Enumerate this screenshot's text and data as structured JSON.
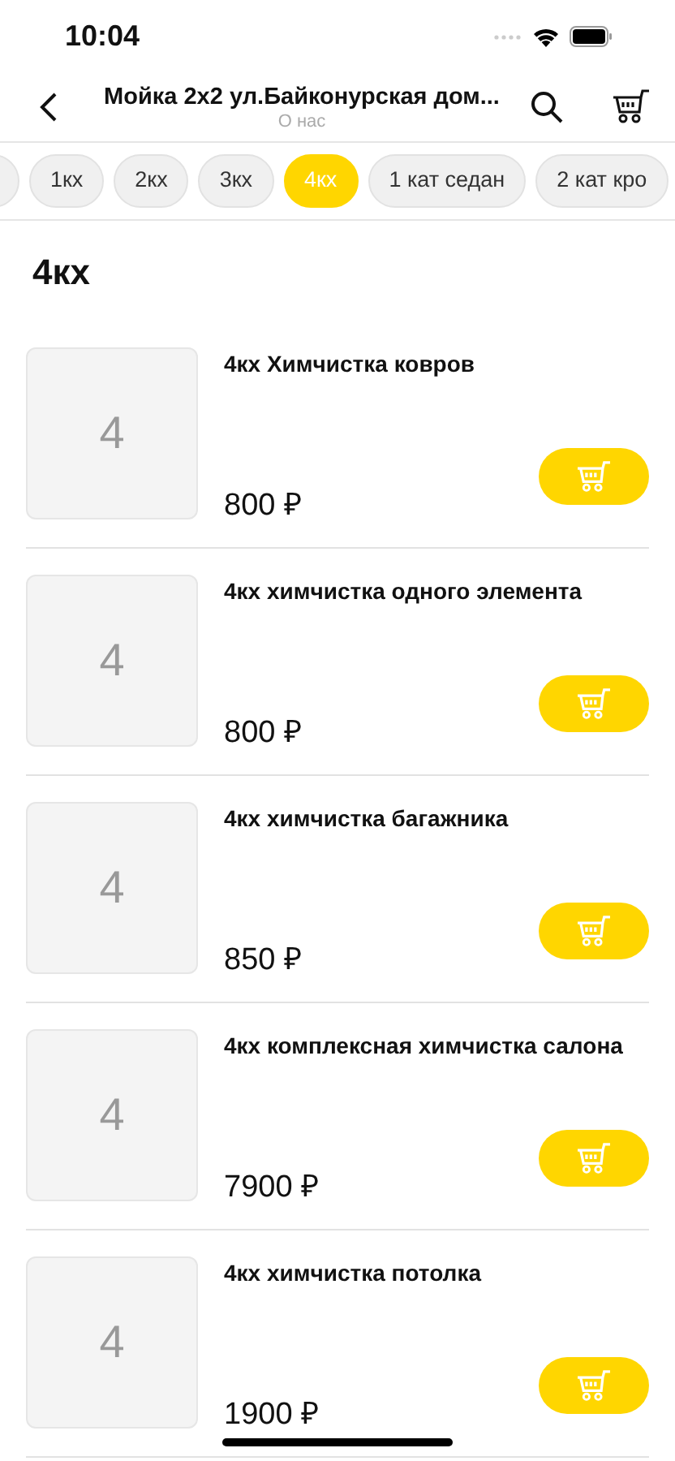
{
  "status_bar": {
    "time": "10:04"
  },
  "header": {
    "title": "Мойка 2х2 ул.Байконурская дом...",
    "subtitle": "О нас"
  },
  "categories": [
    {
      "label": "1кх",
      "selected": false
    },
    {
      "label": "2кх",
      "selected": false
    },
    {
      "label": "3кх",
      "selected": false
    },
    {
      "label": "4кх",
      "selected": true
    },
    {
      "label": "1 кат седан",
      "selected": false
    },
    {
      "label": "2 кат кро",
      "selected": false
    }
  ],
  "section_title": "4кх",
  "products": [
    {
      "thumb": "4",
      "name": "4кх Химчистка ковров",
      "price": "800 ₽"
    },
    {
      "thumb": "4",
      "name": "4кх химчистка одного элемента",
      "price": "800 ₽"
    },
    {
      "thumb": "4",
      "name": "4кх химчистка багажника",
      "price": "850 ₽"
    },
    {
      "thumb": "4",
      "name": "4кх комплексная химчистка салона",
      "price": "7900 ₽"
    },
    {
      "thumb": "4",
      "name": "4кх химчистка потолка",
      "price": "1900 ₽"
    }
  ]
}
